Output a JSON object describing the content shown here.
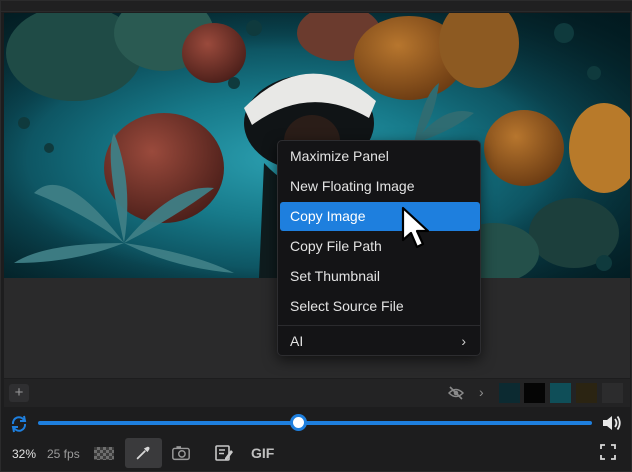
{
  "context_menu": {
    "items": [
      {
        "label": "Maximize Panel"
      },
      {
        "label": "New Floating Image"
      },
      {
        "label": "Copy Image"
      },
      {
        "label": "Copy File Path"
      },
      {
        "label": "Set Thumbnail"
      },
      {
        "label": "Select Source File"
      },
      {
        "label": "AI"
      }
    ],
    "active_item": "Copy Image",
    "submenu_chevron": "›"
  },
  "palette": {
    "add_label": "+",
    "chevron": "›",
    "swatches": [
      "#0c2a31",
      "#050505",
      "#0f4e58",
      "#2b2412",
      "#2c2c2d"
    ]
  },
  "playback": {
    "progress_fraction": 0.47
  },
  "toolbar": {
    "zoom": "32%",
    "fps": "25 fps",
    "gif_label": "GIF"
  },
  "colors": {
    "accent": "#1e7fde",
    "menu_bg": "#141416",
    "panel_bg": "#1d1d1e"
  },
  "icons": [
    "loop-icon",
    "volume-icon",
    "checkerboard-icon",
    "eyedropper-icon",
    "camera-icon",
    "notes-icon",
    "fullscreen-icon",
    "hidden-eye-icon",
    "add-icon",
    "chevron-right-icon"
  ]
}
